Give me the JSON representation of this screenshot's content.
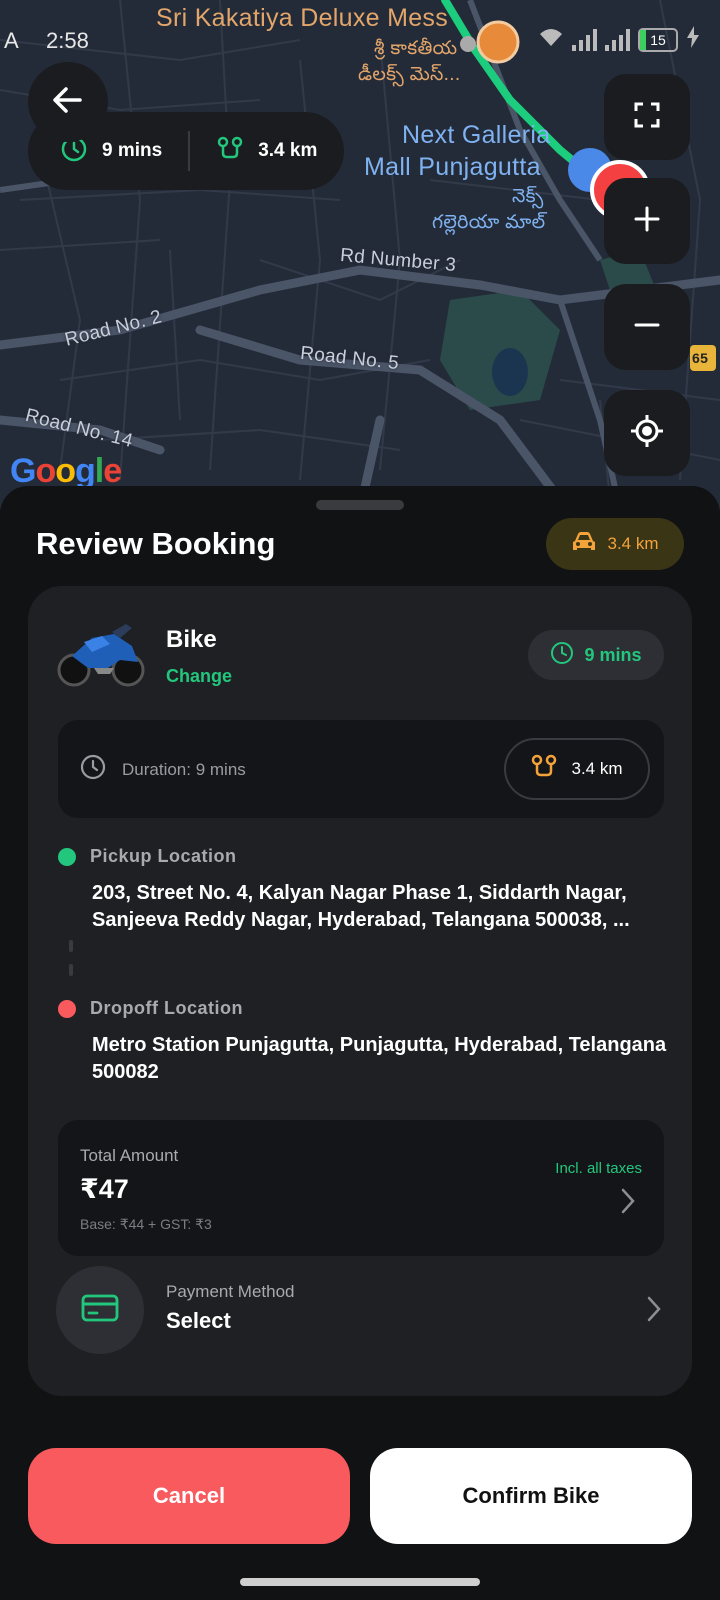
{
  "status_bar": {
    "carrier": "A",
    "time": "2:58",
    "battery": "15"
  },
  "map": {
    "places": {
      "mess_name": "Sri Kakatiya Deluxe Mess",
      "mess_name_te_1": "శ్రీ కాకతీయ",
      "mess_name_te_2": "డీలక్స్ మెస్...",
      "mall_name_1": "Next Galleria",
      "mall_name_2": "Mall Punjagutta",
      "mall_name_te_1": "నెక్స్",
      "mall_name_te_2": "గల్లెరియా మాల్"
    },
    "roads": {
      "rd3": "Rd Number 3",
      "road2": "Road No. 2",
      "road5": "Road No. 5",
      "road14": "Road No. 14",
      "shield": "65"
    },
    "logo": [
      "G",
      "o",
      "o",
      "g",
      "l",
      "e"
    ],
    "eta": {
      "time": "9 mins",
      "distance": "3.4 km"
    }
  },
  "sheet": {
    "title": "Review Booking",
    "distance_badge": "3.4 km",
    "vehicle": {
      "name": "Bike",
      "change_label": "Change",
      "time": "9 mins"
    },
    "duration": {
      "label": "Duration: 9 mins",
      "distance": "3.4 km"
    },
    "pickup": {
      "label": "Pickup Location",
      "address": "203, Street No. 4, Kalyan Nagar Phase 1, Siddarth Nagar, Sanjeeva Reddy Nagar, Hyderabad, Telangana 500038, ..."
    },
    "dropoff": {
      "label": "Dropoff Location",
      "address": "Metro Station Punjagutta, Punjagutta, Hyderabad, Telangana 500082"
    },
    "amount": {
      "label": "Total Amount",
      "value": "₹47",
      "breakup": "Base: ₹44 + GST: ₹3",
      "taxes_note": "Incl. all taxes"
    },
    "payment": {
      "label": "Payment Method",
      "value": "Select"
    },
    "buttons": {
      "cancel": "Cancel",
      "confirm": "Confirm Bike"
    }
  },
  "colors": {
    "accent_green": "#22c77d",
    "cancel_red": "#f85a5e",
    "pickup_dot": "#22c77d",
    "dropoff_dot": "#f85a5e",
    "distance_orange": "#f3a33a"
  }
}
